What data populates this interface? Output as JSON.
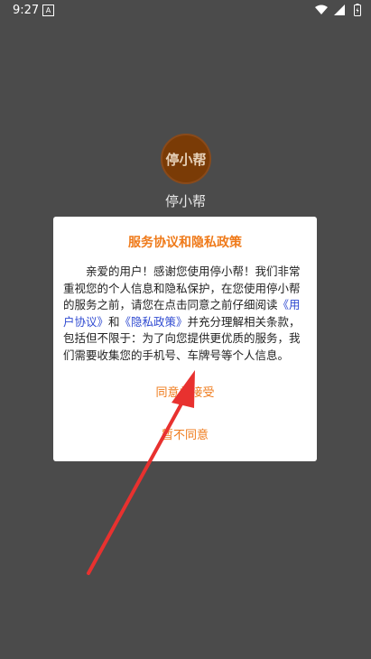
{
  "status_bar": {
    "time": "9:27",
    "notification_icon": "A",
    "icons": [
      "wifi-icon",
      "signal-icon",
      "battery-icon"
    ]
  },
  "app": {
    "logo_text": "停小帮",
    "name": "停小帮"
  },
  "dialog": {
    "title": "服务协议和隐私政策",
    "body_part1": "亲爱的用户！感谢您使用停小帮！我们非常重视您的个人信息和隐私保护，在您使用停小帮的服务之前，请您在点击同意之前仔细阅读",
    "user_agreement_link": "《用户协议》",
    "body_and": "和",
    "privacy_policy_link": "《隐私政策》",
    "body_part2": "并充分理解相关条款，包括但不限于：为了向您提供更优质的服务，我们需要收集您的手机号、车牌号等个人信息。",
    "agree_label": "同意并接受",
    "disagree_label": "暂不同意"
  },
  "colors": {
    "accent": "#ef7a1a",
    "link": "#2f4ad1",
    "overlay": "#4b4b4b",
    "annotation_arrow": "#e8312f"
  }
}
